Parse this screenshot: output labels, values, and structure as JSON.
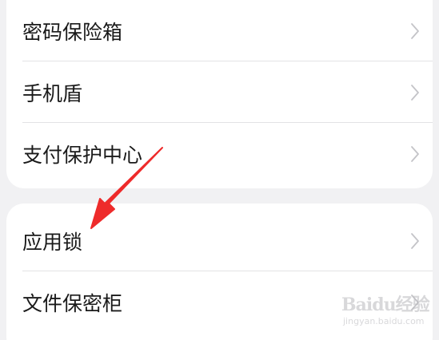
{
  "sections": [
    {
      "items": [
        {
          "label": "密码保险箱"
        },
        {
          "label": "手机盾"
        },
        {
          "label": "支付保护中心"
        }
      ]
    },
    {
      "items": [
        {
          "label": "应用锁"
        },
        {
          "label": "文件保密柜"
        }
      ]
    }
  ],
  "annotation": {
    "color": "#ee2b2b",
    "icon": "red-arrow-pointer"
  },
  "watermark": {
    "brand": "Baidu经验",
    "site": "jingyan.baidu.com"
  },
  "icons": {
    "row_chevron": "chevron-right-icon"
  }
}
